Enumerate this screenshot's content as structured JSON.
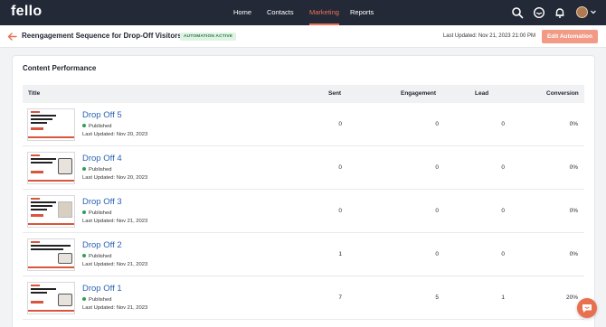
{
  "app": {
    "logo_text": "fello"
  },
  "nav": {
    "items": [
      {
        "label": "Home",
        "active": false
      },
      {
        "label": "Contacts",
        "active": false
      },
      {
        "label": "Marketing",
        "active": true
      },
      {
        "label": "Reports",
        "active": false
      }
    ],
    "icons": [
      "search-icon",
      "inbox-icon",
      "bell-icon",
      "avatar",
      "chevron-down-icon"
    ]
  },
  "header": {
    "title": "Reengagement Sequence for Drop-Off Visitors",
    "status_badge": "AUTOMATION ACTIVE",
    "last_updated": "Last Updated: Nov 21, 2023 21:00 PM",
    "edit_button": "Edit Automation"
  },
  "content": {
    "title": "Content Performance",
    "columns": {
      "title": "Title",
      "sent": "Sent",
      "engagement": "Engagement",
      "lead": "Lead",
      "conversion": "Conversion"
    },
    "rows": [
      {
        "name": "Drop Off 5",
        "status": "Published",
        "updated": "Last Updated: Nov 20, 2023",
        "sent": "0",
        "engagement": "0",
        "lead": "0",
        "conversion": "0%"
      },
      {
        "name": "Drop Off 4",
        "status": "Published",
        "updated": "Last Updated: Nov 20, 2023",
        "sent": "0",
        "engagement": "0",
        "lead": "0",
        "conversion": "0%"
      },
      {
        "name": "Drop Off 3",
        "status": "Published",
        "updated": "Last Updated: Nov 21, 2023",
        "sent": "0",
        "engagement": "0",
        "lead": "0",
        "conversion": "0%"
      },
      {
        "name": "Drop Off 2",
        "status": "Published",
        "updated": "Last Updated: Nov 21, 2023",
        "sent": "1",
        "engagement": "0",
        "lead": "0",
        "conversion": "0%"
      },
      {
        "name": "Drop Off 1",
        "status": "Published",
        "updated": "Last Updated: Nov 21, 2023",
        "sent": "7",
        "engagement": "5",
        "lead": "1",
        "conversion": "20%"
      }
    ]
  },
  "colors": {
    "nav_bg": "#232936",
    "accent": "#f0715a",
    "link": "#2a63b5",
    "published": "#2f9e57",
    "badge_bg": "#dff3e4"
  }
}
